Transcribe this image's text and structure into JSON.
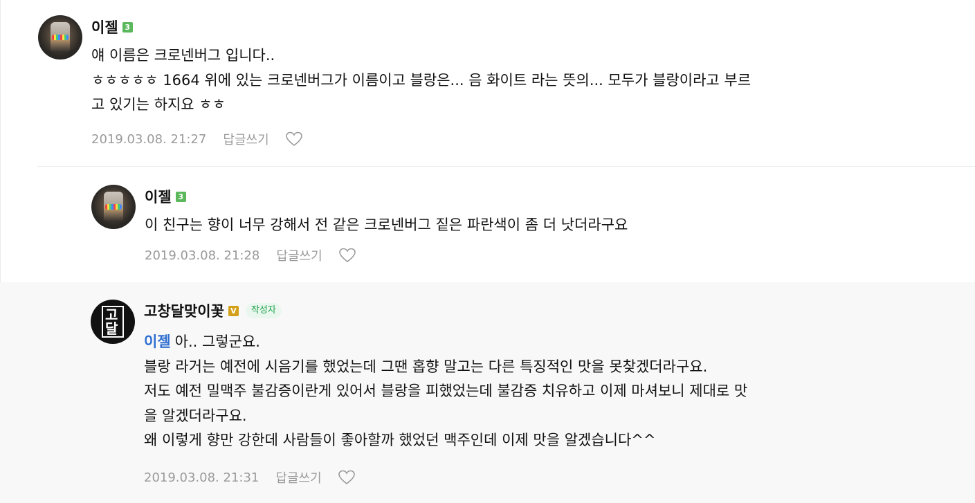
{
  "comments": [
    {
      "author": "이젤",
      "level": "3",
      "lines": [
        "얘 이름은 크로넨버그 입니다..",
        "ㅎㅎㅎㅎㅎ 1664 위에 있는 크로넨버그가 이름이고 블랑은... 음 화이트 라는 뜻의... 모두가 블랑이라고 부르",
        "고 있기는 하지요 ㅎㅎ"
      ],
      "timestamp": "2019.03.08. 21:27",
      "reply_label": "답글쓰기",
      "like_icon": "heart-icon"
    },
    {
      "author": "이젤",
      "level": "3",
      "lines": [
        "이 친구는 향이 너무 강해서 전 같은 크로넨버그 짙은 파란색이 좀 더 낫더라구요"
      ],
      "timestamp": "2019.03.08. 21:28",
      "reply_label": "답글쓰기",
      "like_icon": "heart-icon"
    },
    {
      "author": "고창달맞이꽃",
      "badge": "V",
      "author_tag": "작성자",
      "mention": "이젤",
      "first_line": "아.. 그렇군요.",
      "lines": [
        "블랑 라거는 예전에 시음기를 했었는데 그땐 홉향 말고는 다른 특징적인 맛을 못찾겠더라구요.",
        "저도 예전 밀맥주 불감증이란게 있어서 블랑을 피했었는데 불감증 치유하고 이제 마셔보니 제대로 맛",
        "을 알겠더라구요.",
        "왜 이렇게 향만 강한데 사람들이 좋아할까 했었던 맥주인데 이제 맛을 알겠습니다^^"
      ],
      "timestamp": "2019.03.08. 21:31",
      "reply_label": "답글쓰기",
      "like_icon": "heart-icon",
      "avatar_text": "고달"
    }
  ],
  "colors": {
    "mention": "#2f6fd1",
    "level_badge": "#5cb85c",
    "manager_badge": "#d4a017",
    "author_tag_bg": "#eaf7ee",
    "author_tag_text": "#1aa04a",
    "meta_text": "#9a9a9a",
    "reply_bg": "#f8f8f8"
  }
}
